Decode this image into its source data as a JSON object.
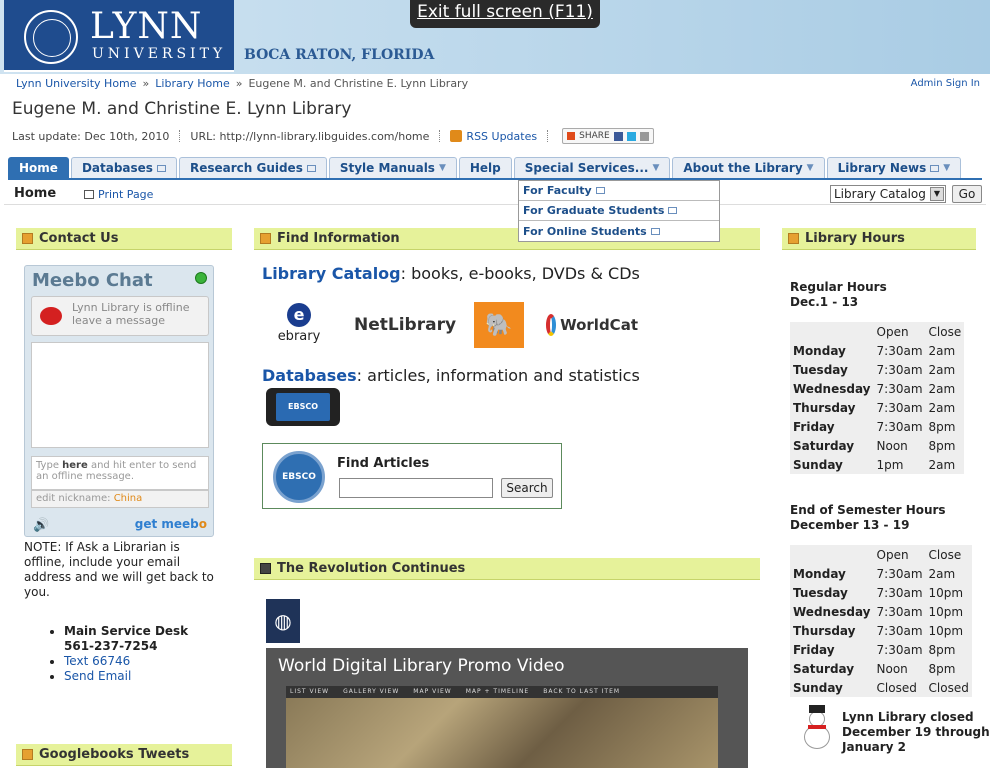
{
  "banner": {
    "logo_line1": "LYNN",
    "logo_line2": "UNIVERSITY",
    "city": "BOCA RATON, FLORIDA",
    "fullscreen_notice": "Exit full screen (F11)"
  },
  "breadcrumb": {
    "items": [
      "Lynn University Home",
      "Library Home",
      "Eugene M. and Christine E. Lynn Library"
    ],
    "separator": "»"
  },
  "admin_link": "Admin Sign In",
  "page_title": "Eugene M. and Christine E. Lynn Library",
  "meta": {
    "last_update": "Last update: Dec 10th, 2010",
    "url": "URL: http://lynn-library.libguides.com/home",
    "rss": "RSS Updates",
    "share": "SHARE"
  },
  "tabs": [
    {
      "label": "Home",
      "active": true
    },
    {
      "label": "Databases",
      "active": false
    },
    {
      "label": "Research Guides",
      "active": false
    },
    {
      "label": "Style Manuals",
      "active": false
    },
    {
      "label": "Help",
      "active": false
    },
    {
      "label": "Special Services...",
      "active": false
    },
    {
      "label": "About the Library",
      "active": false
    },
    {
      "label": "Library News",
      "active": false
    }
  ],
  "subbar": {
    "home": "Home",
    "print": "Print Page",
    "catalog_select": "Library Catalog",
    "go": "Go"
  },
  "dropdown": [
    "For Faculty",
    "For Graduate Students",
    "For Online Students"
  ],
  "contact": {
    "heading": "Contact Us",
    "meebo_title": "Meebo Chat",
    "meebo_status_line1": "Lynn Library is offline",
    "meebo_status_line2": "leave a message",
    "meebo_input_pre": "Type ",
    "meebo_input_here": "here",
    "meebo_input_post": " and hit enter to send an offline message.",
    "meebo_nick_label": "edit nickname: ",
    "meebo_nick": "China",
    "getmeebo_pre": "get meeb",
    "getmeebo_post": "o",
    "note": "NOTE:  If Ask a Librarian is offline, include your email address and we will get back to you.",
    "desk_label": "Main Service Desk",
    "desk_phone": "561-237-7254",
    "text": "Text  66746",
    "email": "Send Email"
  },
  "googlebooks_heading": "Googlebooks Tweets",
  "find": {
    "heading": "Find Information",
    "catalog_link": "Library Catalog",
    "catalog_desc": ": books, e-books, DVDs & CDs",
    "logo_ebrary": "ebrary",
    "logo_netlibrary": "NetLibrary",
    "logo_worldcat": "WorldCat",
    "databases_link": "Databases",
    "databases_desc": ": articles, information and statistics",
    "ebsco": "EBSCO HOST",
    "find_articles": "Find Articles",
    "search": "Search"
  },
  "revolution": {
    "heading": "The Revolution Continues",
    "video_title": "World Digital Library Promo Video",
    "video_nav": [
      "LIST VIEW",
      "GALLERY VIEW",
      "MAP VIEW",
      "MAP + TIMELINE",
      "BACK TO LAST ITEM"
    ]
  },
  "hours": {
    "heading": "Library Hours",
    "regular_title": "Regular Hours",
    "regular_dates": "Dec.1 - 13",
    "col_open": "Open",
    "col_close": "Close",
    "regular": [
      {
        "day": "Monday",
        "open": "7:30am",
        "close": "2am"
      },
      {
        "day": "Tuesday",
        "open": "7:30am",
        "close": "2am"
      },
      {
        "day": "Wednesday",
        "open": "7:30am",
        "close": "2am"
      },
      {
        "day": "Thursday",
        "open": "7:30am",
        "close": "2am"
      },
      {
        "day": "Friday",
        "open": "7:30am",
        "close": "8pm"
      },
      {
        "day": "Saturday",
        "open": "Noon",
        "close": "8pm"
      },
      {
        "day": "Sunday",
        "open": "1pm",
        "close": "2am"
      }
    ],
    "semester_title": "End of Semester Hours",
    "semester_dates": "December 13 - 19",
    "semester": [
      {
        "day": "Monday",
        "open": "7:30am",
        "close": "2am"
      },
      {
        "day": "Tuesday",
        "open": "7:30am",
        "close": "10pm"
      },
      {
        "day": "Wednesday",
        "open": "7:30am",
        "close": "10pm"
      },
      {
        "day": "Thursday",
        "open": "7:30am",
        "close": "10pm"
      },
      {
        "day": "Friday",
        "open": "7:30am",
        "close": "8pm"
      },
      {
        "day": "Saturday",
        "open": "Noon",
        "close": "8pm"
      },
      {
        "day": "Sunday",
        "open": "Closed",
        "close": "Closed"
      }
    ],
    "closed_note": [
      "Lynn Library closed",
      "December 19 through",
      "January 2"
    ]
  }
}
